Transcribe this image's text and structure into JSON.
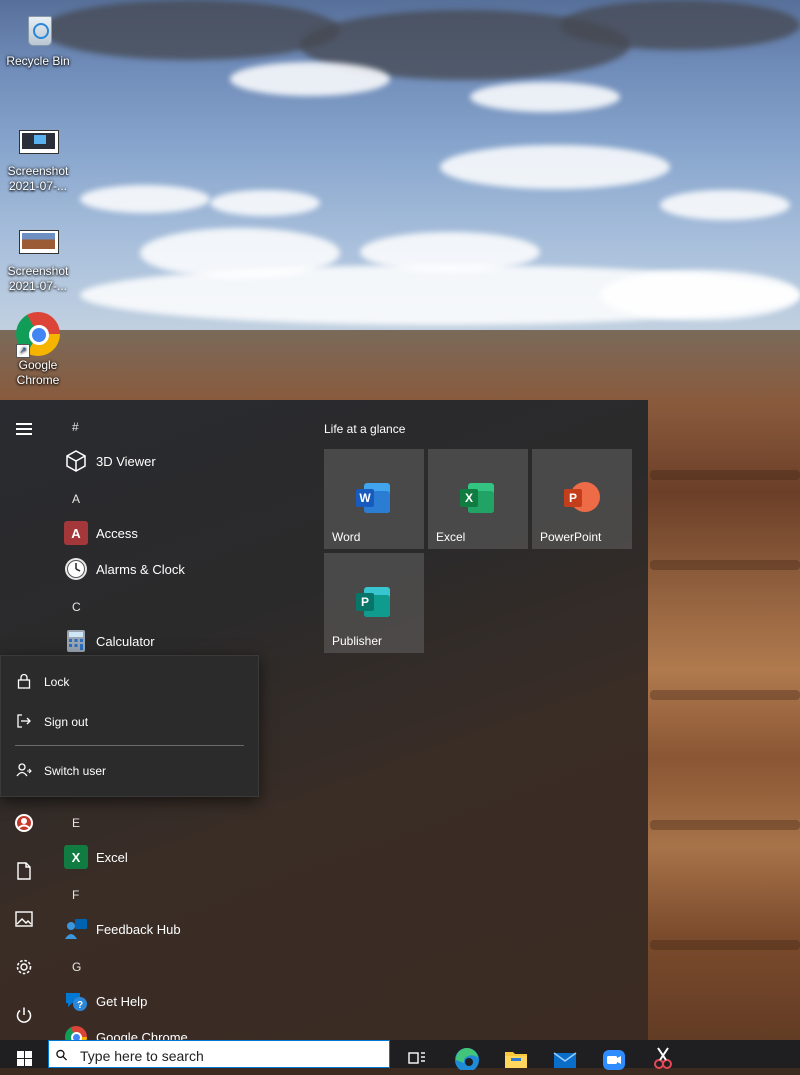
{
  "desktop": {
    "icons": [
      {
        "label": "Recycle Bin",
        "icon": "recycle-bin-icon"
      },
      {
        "label": "Screenshot 2021-07-...",
        "icon": "image-file-icon"
      },
      {
        "label": "Screenshot 2021-07-...",
        "icon": "image-file-icon"
      },
      {
        "label": "Google Chrome",
        "icon": "chrome-icon"
      }
    ]
  },
  "start_menu": {
    "rail": {
      "menu_icon": "hamburger-icon",
      "items": [
        "user-icon",
        "documents-icon",
        "pictures-icon",
        "settings-icon",
        "power-icon"
      ]
    },
    "app_list": {
      "groups": [
        {
          "letter": "#",
          "apps": [
            {
              "name": "3D Viewer",
              "icon": "3d-viewer-icon"
            }
          ]
        },
        {
          "letter": "A",
          "apps": [
            {
              "name": "Access",
              "icon": "access-icon"
            },
            {
              "name": "Alarms & Clock",
              "icon": "alarms-clock-icon"
            }
          ]
        },
        {
          "letter": "C",
          "apps": [
            {
              "name": "Calculator",
              "icon": "calculator-icon"
            }
          ]
        },
        {
          "letter": "E",
          "apps": [
            {
              "name": "Excel",
              "icon": "excel-icon"
            }
          ]
        },
        {
          "letter": "F",
          "apps": [
            {
              "name": "Feedback Hub",
              "icon": "feedback-hub-icon"
            }
          ]
        },
        {
          "letter": "G",
          "apps": [
            {
              "name": "Get Help",
              "icon": "get-help-icon"
            },
            {
              "name": "Google Chrome",
              "icon": "chrome-icon"
            }
          ]
        }
      ]
    },
    "tiles": {
      "heading": "Life at a glance",
      "items": [
        {
          "label": "Word",
          "letter": "W",
          "color": "#185abd"
        },
        {
          "label": "Excel",
          "letter": "X",
          "color": "#107c41"
        },
        {
          "label": "PowerPoint",
          "letter": "P",
          "color": "#c43e1c"
        },
        {
          "label": "Publisher",
          "letter": "P",
          "color": "#077568"
        }
      ]
    },
    "user_flyout": {
      "lock": "Lock",
      "sign_out": "Sign out",
      "switch_user": "Switch user"
    }
  },
  "taskbar": {
    "search_placeholder": "Type here to search",
    "pinned": [
      "task-view-icon",
      "edge-icon",
      "file-explorer-icon",
      "mail-icon",
      "zoom-icon",
      "snipping-tool-icon"
    ]
  },
  "colors": {
    "accent": "#0078d4",
    "word": "#185abd",
    "excel": "#107c41",
    "powerpoint": "#c43e1c",
    "publisher": "#077568",
    "access": "#a4373a"
  }
}
